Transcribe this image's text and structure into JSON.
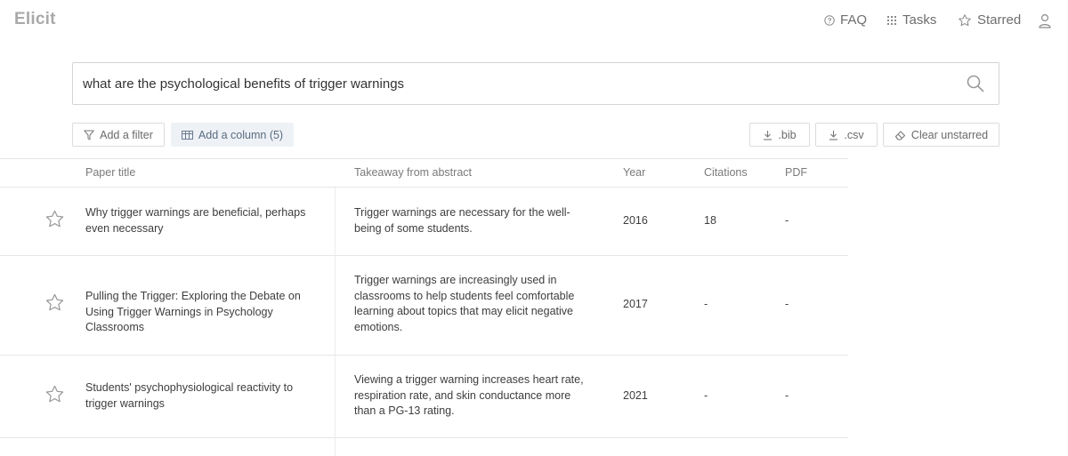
{
  "app": {
    "logo": "Elicit"
  },
  "nav": {
    "faq": "FAQ",
    "tasks": "Tasks",
    "starred": "Starred"
  },
  "search": {
    "value": "what are the psychological benefits of trigger warnings"
  },
  "toolbar": {
    "filter_label": "Add a filter",
    "column_label": "Add a column (5)",
    "bib_label": ".bib",
    "csv_label": ".csv",
    "clear_label": "Clear unstarred"
  },
  "table": {
    "headers": {
      "title": "Paper title",
      "takeaway": "Takeaway from abstract",
      "year": "Year",
      "citations": "Citations",
      "pdf": "PDF"
    },
    "rows": [
      {
        "title": "Why trigger warnings are beneficial, perhaps even necessary",
        "takeaway": "Trigger warnings are necessary for the well-being of some students.",
        "year": "2016",
        "citations": "18",
        "pdf": "-"
      },
      {
        "title": "Pulling the Trigger: Exploring the Debate on Using Trigger Warnings in Psychology Classrooms",
        "takeaway": "Trigger warnings are increasingly used in classrooms to help students feel comfortable learning about topics that may elicit negative emotions.",
        "year": "2017",
        "citations": "-",
        "pdf": "-"
      },
      {
        "title": "Students' psychophysiological reactivity to trigger warnings",
        "takeaway": "Viewing a trigger warning increases heart rate, respiration rate, and skin conductance more than a PG-13 rating.",
        "year": "2021",
        "citations": "-",
        "pdf": "-"
      }
    ]
  },
  "colors": {
    "accent_bg": "#eef2f6",
    "border": "#d4d4d4",
    "text": "#3d3d3d",
    "muted": "#7a7a7a"
  }
}
